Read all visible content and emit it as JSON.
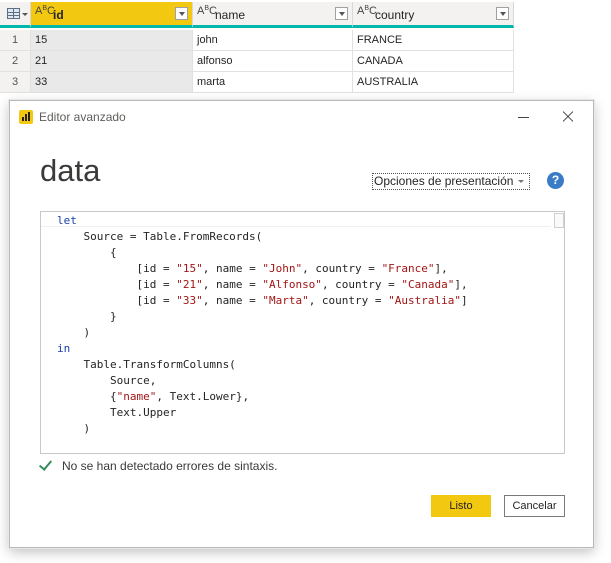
{
  "grid": {
    "columns": [
      {
        "name": "id",
        "type_a": "A",
        "type_bc": "B",
        "type_c": "C"
      },
      {
        "name": "name",
        "type_a": "A",
        "type_bc": "B",
        "type_c": "C"
      },
      {
        "name": "country",
        "type_a": "A",
        "type_bc": "B",
        "type_c": "C"
      }
    ],
    "rows": [
      {
        "num": "1",
        "id": "15",
        "name": "john",
        "country": "FRANCE"
      },
      {
        "num": "2",
        "id": "21",
        "name": "alfonso",
        "country": "CANADA"
      },
      {
        "num": "3",
        "id": "33",
        "name": "marta",
        "country": "AUSTRALIA"
      }
    ],
    "selected_column": "id",
    "accent_color": "#01b8aa",
    "selected_color": "#f2c811"
  },
  "dialog": {
    "title": "Editor avanzado",
    "query_name": "data",
    "display_options_label": "Opciones de presentación",
    "help_glyph": "?",
    "status_text": "No se han detectado errores de sintaxis.",
    "ok_label": "Listo",
    "cancel_label": "Cancelar",
    "brand_color": "#f2c811"
  },
  "code": {
    "lines": [
      [
        {
          "t": "let",
          "c": "kw"
        }
      ],
      [
        {
          "t": "    Source = Table.FromRecords("
        }
      ],
      [
        {
          "t": "        {"
        }
      ],
      [
        {
          "t": "            [id = "
        },
        {
          "t": "\"15\"",
          "c": "str"
        },
        {
          "t": ", name = "
        },
        {
          "t": "\"John\"",
          "c": "str"
        },
        {
          "t": ", country = "
        },
        {
          "t": "\"France\"",
          "c": "str"
        },
        {
          "t": "],"
        }
      ],
      [
        {
          "t": "            [id = "
        },
        {
          "t": "\"21\"",
          "c": "str"
        },
        {
          "t": ", name = "
        },
        {
          "t": "\"Alfonso\"",
          "c": "str"
        },
        {
          "t": ", country = "
        },
        {
          "t": "\"Canada\"",
          "c": "str"
        },
        {
          "t": "],"
        }
      ],
      [
        {
          "t": "            [id = "
        },
        {
          "t": "\"33\"",
          "c": "str"
        },
        {
          "t": ", name = "
        },
        {
          "t": "\"Marta\"",
          "c": "str"
        },
        {
          "t": ", country = "
        },
        {
          "t": "\"Australia\"",
          "c": "str"
        },
        {
          "t": "]"
        }
      ],
      [
        {
          "t": "        }"
        }
      ],
      [
        {
          "t": "    )"
        }
      ],
      [
        {
          "t": "in",
          "c": "kw"
        }
      ],
      [
        {
          "t": "    Table.TransformColumns("
        }
      ],
      [
        {
          "t": "        Source,"
        }
      ],
      [
        {
          "t": "        {"
        },
        {
          "t": "\"name\"",
          "c": "str"
        },
        {
          "t": ", Text.Lower},"
        }
      ],
      [
        {
          "t": "        Text.Upper"
        }
      ],
      [
        {
          "t": "    )"
        }
      ]
    ]
  }
}
